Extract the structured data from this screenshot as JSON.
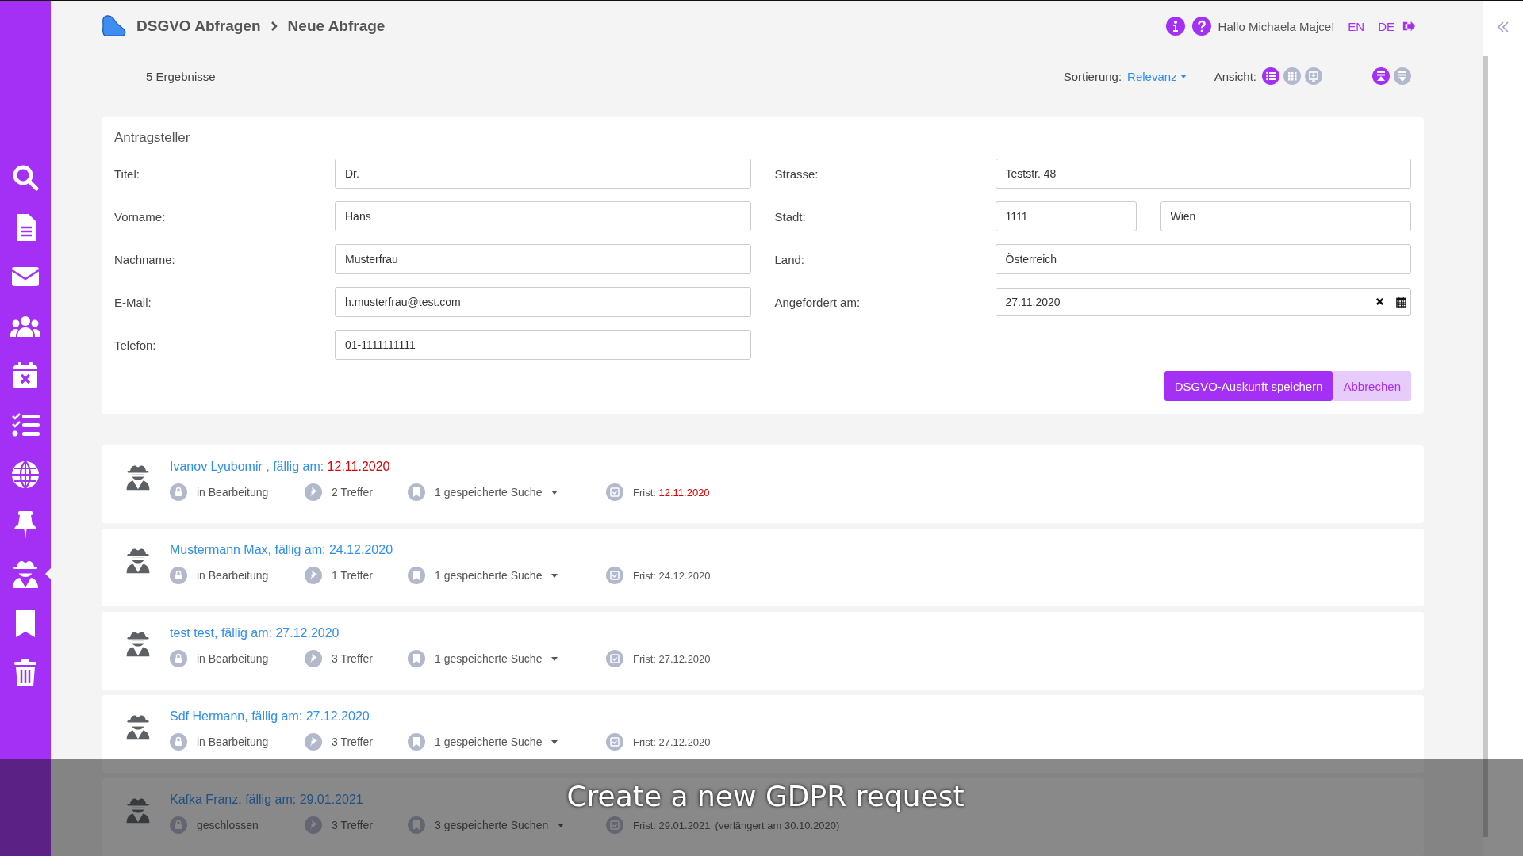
{
  "sidebar": {
    "items": [
      {
        "selected": false
      },
      {
        "selected": false
      },
      {
        "selected": false
      },
      {
        "selected": false
      },
      {
        "selected": false
      },
      {
        "selected": false
      },
      {
        "selected": false
      },
      {
        "selected": false
      },
      {
        "selected": true
      },
      {
        "selected": false
      },
      {
        "selected": false
      }
    ]
  },
  "breadcrumb": [
    "DSGVO Abfragen",
    "Neue Abfrage"
  ],
  "header": {
    "greeting": "Hallo Michaela Majce!",
    "languages": [
      {
        "label": "EN"
      },
      {
        "label": "DE"
      }
    ]
  },
  "toolbar": {
    "results": "5 Ergebnisse",
    "sort_label": "Sortierung:",
    "sort_value": "Relevanz",
    "view_label": "Ansicht:",
    "views": [
      {
        "selected": true
      },
      {
        "selected": false
      },
      {
        "selected": false
      }
    ],
    "order": [
      {
        "selected": true
      },
      {
        "selected": false
      }
    ]
  },
  "form": {
    "title": "Antragsteller",
    "left": [
      {
        "label": "Titel:",
        "value": "Dr."
      },
      {
        "label": "Vorname:",
        "value": "Hans"
      },
      {
        "label": "Nachname:",
        "value": "Musterfrau"
      },
      {
        "label": "E-Mail:",
        "value": "h.musterfrau@test.com"
      },
      {
        "label": "Telefon:",
        "value": "01-1111111111"
      }
    ],
    "right": [
      {
        "kind": "text",
        "label": "Strasse:",
        "values": [
          "Teststr. 48"
        ]
      },
      {
        "kind": "split",
        "label": "Stadt:",
        "values": [
          "1111",
          "Wien"
        ]
      },
      {
        "kind": "text",
        "label": "Land:",
        "values": [
          "Österreich"
        ]
      },
      {
        "kind": "date",
        "label": "Angefordert am:",
        "values": [
          "27.11.2020"
        ]
      }
    ],
    "buttons": [
      {
        "kind": "primary",
        "label": "DSGVO-Auskunft speichern"
      },
      {
        "kind": "secondary",
        "label": "Abbrechen"
      }
    ]
  },
  "requests": [
    {
      "title": "Ivanov Lyubomir , fällig am:",
      "due": "12.11.2020",
      "overdue": true,
      "status": "in Bearbeitung",
      "hits": "2 Treffer",
      "searches": "1 gespeicherte Suche",
      "deadline_label": "Frist:",
      "deadline": "12.11.2020"
    },
    {
      "title": "Mustermann Max, fällig am:",
      "due": "24.12.2020",
      "overdue": false,
      "status": "in Bearbeitung",
      "hits": "1 Treffer",
      "searches": "1 gespeicherte Suche",
      "deadline_label": "Frist:",
      "deadline": "24.12.2020"
    },
    {
      "title": "test test, fällig am:",
      "due": "27.12.2020",
      "overdue": false,
      "status": "in Bearbeitung",
      "hits": "3 Treffer",
      "searches": "1 gespeicherte Suche",
      "deadline_label": "Frist:",
      "deadline": "27.12.2020"
    },
    {
      "title": "Sdf Hermann, fällig am:",
      "due": "27.12.2020",
      "overdue": false,
      "status": "in Bearbeitung",
      "hits": "3 Treffer",
      "searches": "1 gespeicherte Suche",
      "deadline_label": "Frist:",
      "deadline": "27.12.2020"
    },
    {
      "title": "Kafka Franz, fällig am:",
      "due": "29.01.2021",
      "overdue": false,
      "status": "geschlossen",
      "hits": "3 Treffer",
      "searches": "3 gespeicherte Suchen",
      "deadline_label": "Frist:",
      "deadline": "29.01.2021",
      "extension": "(verlängert am 30.10.2020)"
    }
  ],
  "caption": "Create a new GDPR request"
}
